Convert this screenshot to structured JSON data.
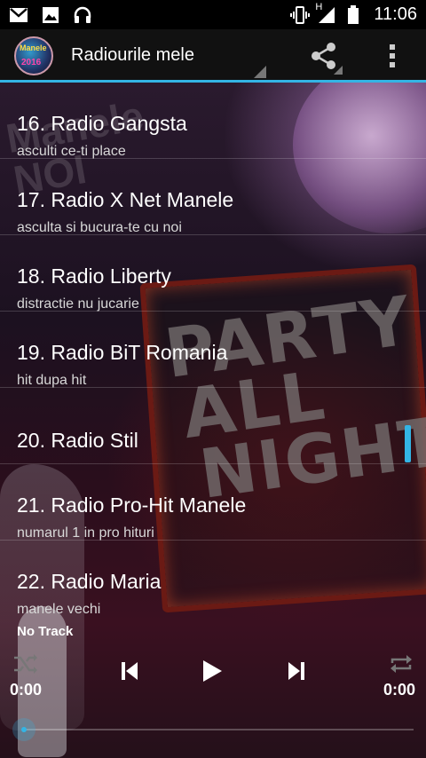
{
  "status_bar": {
    "left_icons": [
      "gmail-icon",
      "image-icon",
      "headset-icon"
    ],
    "right_icons": [
      "vibrate-icon",
      "signal-icon",
      "battery-icon"
    ],
    "network_type": "H",
    "time": "11:06"
  },
  "action_bar": {
    "logo_text_top": "Manele",
    "logo_text_year": "2016",
    "title": "Radiourile mele"
  },
  "stations": [
    {
      "name": "16. Radio Gangsta",
      "subtitle": "asculti ce-ti place"
    },
    {
      "name": "17. Radio X Net Manele",
      "subtitle": "asculta si bucura-te cu noi"
    },
    {
      "name": "18. Radio Liberty",
      "subtitle": "distractie nu jucarie"
    },
    {
      "name": "19. Radio BiT Romania",
      "subtitle": "hit dupa hit"
    },
    {
      "name": "20. Radio Stil",
      "subtitle": ""
    },
    {
      "name": "21. Radio Pro-Hit Manele",
      "subtitle": "numarul 1 in pro hituri"
    },
    {
      "name": "22. Radio Maria",
      "subtitle": "manele vechi"
    }
  ],
  "background_art": {
    "words": [
      "PARTY",
      "ALL",
      "NIGHT"
    ],
    "faded_text": "Manele NOI"
  },
  "player": {
    "track": "No Track",
    "elapsed": "0:00",
    "duration": "0:00",
    "progress": 0
  },
  "colors": {
    "accent": "#33b5e5",
    "action_bar": "#111111",
    "status_bar": "#000000"
  }
}
